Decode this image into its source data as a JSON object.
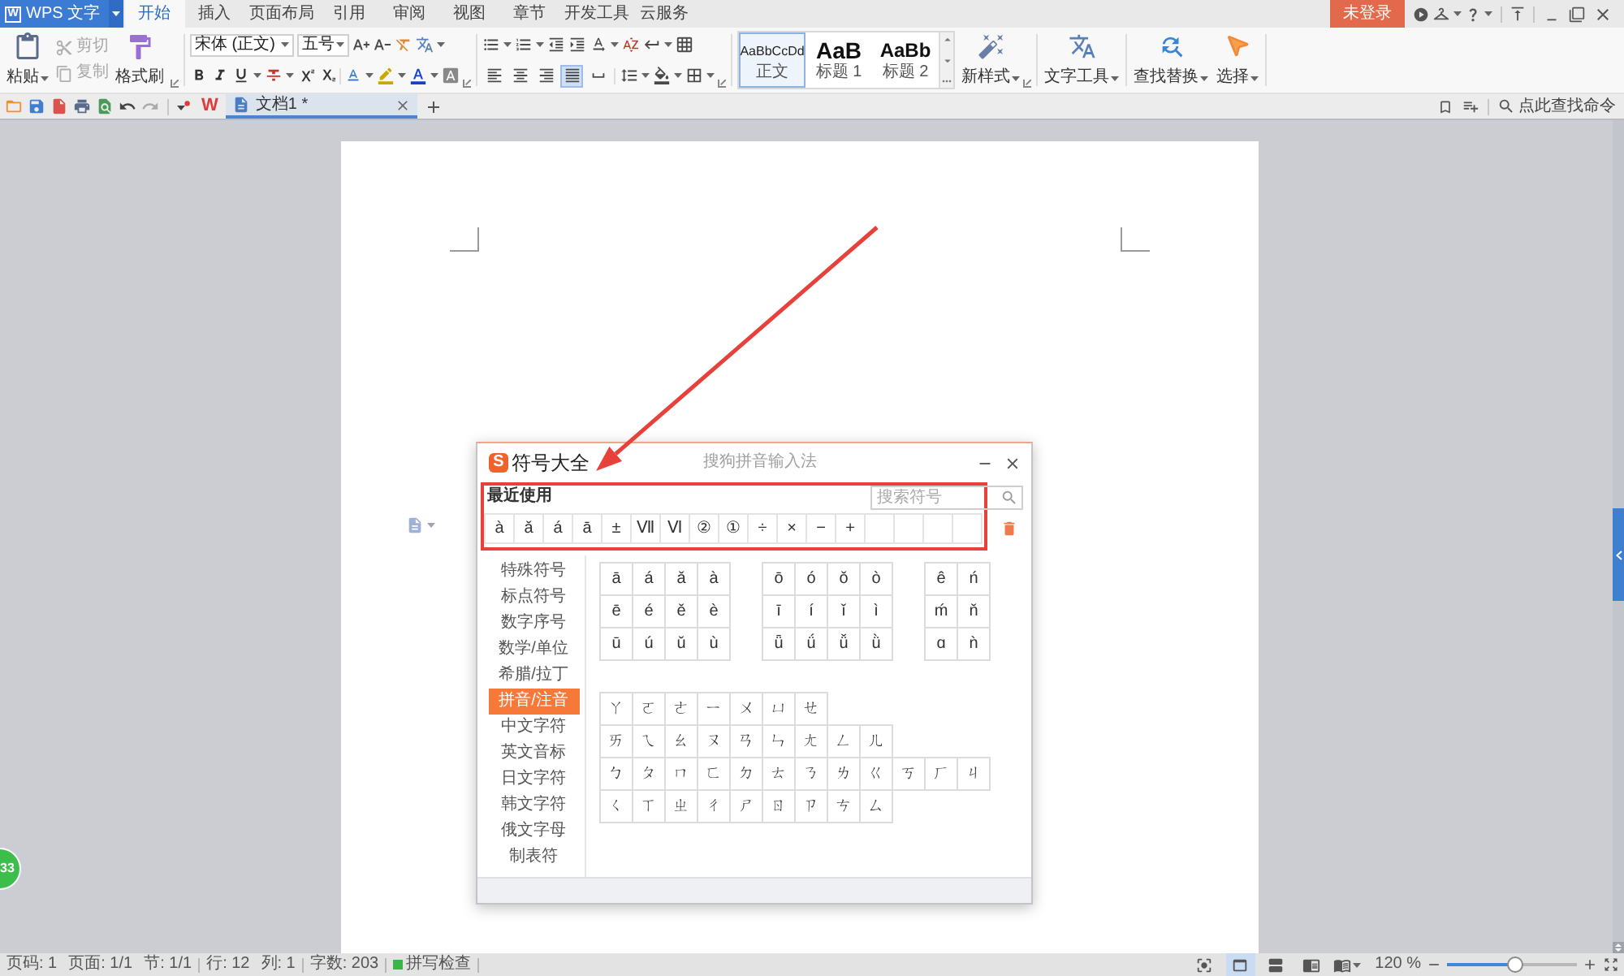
{
  "title_bar": {
    "app_menu": {
      "logo": "W",
      "label": "WPS 文字"
    },
    "tabs": [
      {
        "label": "开始",
        "selected": true
      },
      {
        "label": "插入",
        "selected": false
      },
      {
        "label": "页面布局",
        "selected": false
      },
      {
        "label": "引用",
        "selected": false
      },
      {
        "label": "审阅",
        "selected": false
      },
      {
        "label": "视图",
        "selected": false
      },
      {
        "label": "章节",
        "selected": false
      },
      {
        "label": "开发工具",
        "selected": false
      },
      {
        "label": "云服务",
        "selected": false
      }
    ],
    "login_button": "未登录"
  },
  "ribbon": {
    "paste": "粘贴",
    "cut": {
      "label": "剪切",
      "disabled": true
    },
    "copy": {
      "label": "复制",
      "disabled": true
    },
    "format_painter": "格式刷",
    "font_name": "宋体 (正文)",
    "font_size": "五号",
    "alignments": [
      {
        "kind": "left",
        "selected": false
      },
      {
        "kind": "center",
        "selected": false
      },
      {
        "kind": "right",
        "selected": false
      },
      {
        "kind": "justify",
        "selected": true
      },
      {
        "kind": "distributed",
        "selected": false
      }
    ],
    "styles": [
      {
        "kind": "body",
        "preview": "AaBbCcDd",
        "label": "正文",
        "selected": true
      },
      {
        "kind": "heading1",
        "preview": "AaB",
        "label": "标题 1",
        "selected": false
      },
      {
        "kind": "heading2",
        "preview": "AaBb",
        "label": "标题 2",
        "selected": false
      }
    ],
    "new_style": "新样式",
    "text_tools": "文字工具",
    "find_replace": "查找替换",
    "select": "选择"
  },
  "tab_bar": {
    "logo": "W",
    "document_tab": "文档1 *",
    "command_search": {
      "placeholder": "点此查找命令"
    }
  },
  "badge": "33",
  "symbol_dialog": {
    "logo": "S",
    "title": "符号大全",
    "subtitle": "搜狗拼音输入法",
    "recent_label": "最近使用",
    "search": {
      "placeholder": "搜索符号"
    },
    "recent": [
      "à",
      "ǎ",
      "á",
      "ā",
      "±",
      "Ⅶ",
      "Ⅵ",
      "②",
      "①",
      "÷",
      "×",
      "−",
      "+"
    ],
    "categories": [
      {
        "label": "特殊符号",
        "selected": false
      },
      {
        "label": "标点符号",
        "selected": false
      },
      {
        "label": "数字序号",
        "selected": false
      },
      {
        "label": "数学/单位",
        "selected": false
      },
      {
        "label": "希腊/拉丁",
        "selected": false
      },
      {
        "label": "拼音/注音",
        "selected": true
      },
      {
        "label": "中文字符",
        "selected": false
      },
      {
        "label": "英文音标",
        "selected": false
      },
      {
        "label": "日文字符",
        "selected": false
      },
      {
        "label": "韩文字符",
        "selected": false
      },
      {
        "label": "俄文字母",
        "selected": false
      },
      {
        "label": "制表符",
        "selected": false
      }
    ],
    "pinyin_groups": [
      [
        [
          "ā",
          "á",
          "ǎ",
          "à"
        ],
        [
          "ē",
          "é",
          "ě",
          "è"
        ],
        [
          "ū",
          "ú",
          "ǔ",
          "ù"
        ]
      ],
      [
        [
          "ō",
          "ó",
          "ǒ",
          "ò"
        ],
        [
          "ī",
          "í",
          "ǐ",
          "ì"
        ],
        [
          "ǖ",
          "ǘ",
          "ǚ",
          "ǜ"
        ]
      ],
      [
        [
          "ê",
          "ń"
        ],
        [
          "ḿ",
          "ň"
        ],
        [
          "ɑ",
          "ǹ"
        ]
      ]
    ],
    "zhuyin_rows": [
      [
        "ㄚ",
        "ㄛ",
        "ㄜ",
        "ㄧ",
        "ㄨ",
        "ㄩ",
        "ㄝ"
      ],
      [
        "ㄞ",
        "ㄟ",
        "ㄠ",
        "ㄡ",
        "ㄢ",
        "ㄣ",
        "ㄤ",
        "ㄥ",
        "ㄦ"
      ],
      [
        "ㄅ",
        "ㄆ",
        "ㄇ",
        "ㄈ",
        "ㄉ",
        "ㄊ",
        "ㄋ",
        "ㄌ",
        "ㄍ",
        "ㄎ",
        "ㄏ",
        "ㄐ"
      ],
      [
        "ㄑ",
        "ㄒ",
        "ㄓ",
        "ㄔ",
        "ㄕ",
        "ㄖ",
        "ㄗ",
        "ㄘ",
        "ㄙ"
      ]
    ]
  },
  "status_bar": {
    "groups": [
      [
        "页码: 1",
        "页面: 1/1",
        "节: 1/1"
      ],
      [
        "行: 12",
        "列: 1"
      ],
      [
        "字数: 203"
      ]
    ],
    "spell_check": "拼写检查",
    "view_buttons": [
      {
        "kind": "focus",
        "selected": false
      },
      {
        "kind": "page",
        "selected": true
      },
      {
        "kind": "outline",
        "selected": false
      },
      {
        "kind": "web",
        "selected": false
      },
      {
        "kind": "reading",
        "selected": false
      }
    ],
    "zoom": "120 %",
    "zoom_slider": {
      "level": 0.52
    }
  }
}
